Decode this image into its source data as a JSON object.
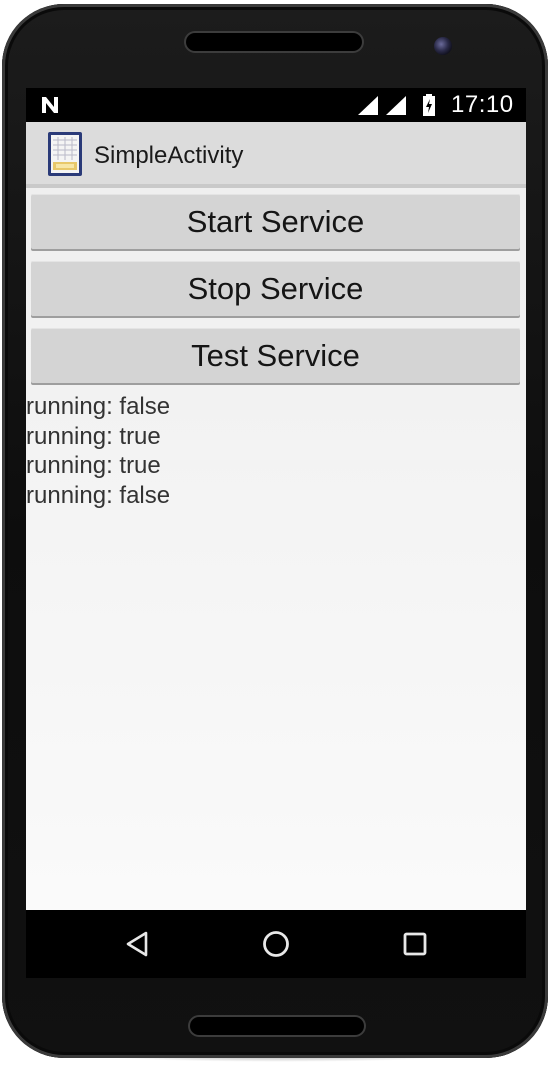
{
  "status_bar": {
    "time": "17:10",
    "icons": [
      "n-notification-icon",
      "signal-icon",
      "signal-icon",
      "battery-charging-icon"
    ]
  },
  "app_bar": {
    "title": "SimpleActivity",
    "icon": "app-icon"
  },
  "buttons": {
    "start": "Start Service",
    "stop": "Stop Service",
    "test": "Test Service"
  },
  "log": [
    "running: false",
    "running: true",
    "running: true",
    "running: false"
  ],
  "nav_bar": {
    "icons": [
      "back-icon",
      "home-icon",
      "recents-icon"
    ]
  }
}
